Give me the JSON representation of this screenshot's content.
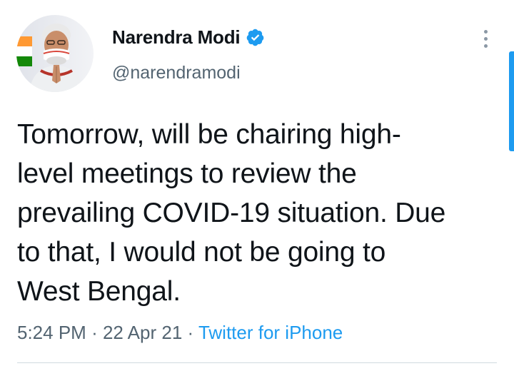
{
  "tweet": {
    "author": {
      "display_name": "Narendra Modi",
      "handle": "@narendramodi",
      "verified": true,
      "avatar_icon": "profile-photo"
    },
    "text": "Tomorrow, will be chairing high-\nlevel meetings to review the\nprevailing COVID-19 situation. Due\nto that, I would not be going to\nWest Bengal.",
    "time": "5:24 PM",
    "date": "22 Apr 21",
    "separator": "·",
    "source": "Twitter for iPhone",
    "more_icon": "more-vertical-icon"
  },
  "colors": {
    "text_primary": "#0f1419",
    "text_secondary": "#536471",
    "link": "#1d9bf0",
    "verified_badge": "#1d9bf0",
    "divider": "#cfd9de"
  }
}
